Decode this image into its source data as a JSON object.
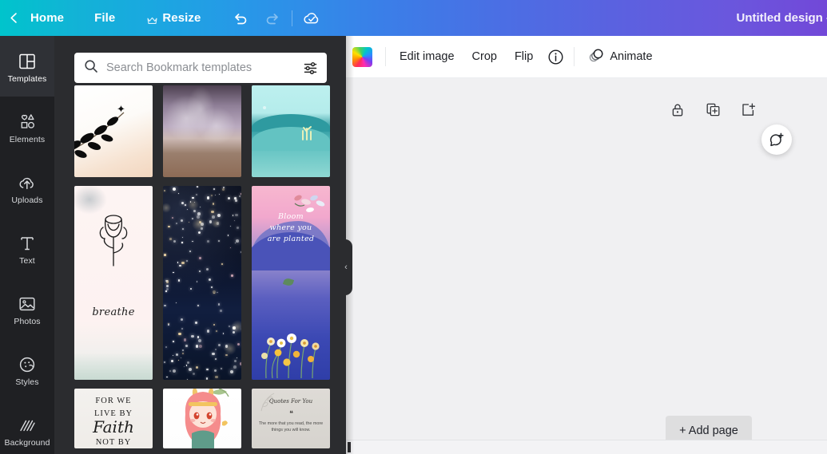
{
  "topbar": {
    "back_icon": "chevron-left-icon",
    "home_label": "Home",
    "file_label": "File",
    "resize_label": "Resize",
    "resize_icon": "crown-icon",
    "undo_icon": "undo-icon",
    "redo_icon": "redo-icon",
    "saved_icon": "cloud-check-icon",
    "doc_title": "Untitled design -"
  },
  "rail": {
    "items": [
      {
        "label": "Templates",
        "icon": "templates-icon",
        "active": true
      },
      {
        "label": "Elements",
        "icon": "elements-icon",
        "active": false
      },
      {
        "label": "Uploads",
        "icon": "upload-cloud-icon",
        "active": false
      },
      {
        "label": "Text",
        "icon": "text-icon",
        "active": false
      },
      {
        "label": "Photos",
        "icon": "photo-icon",
        "active": false
      },
      {
        "label": "Styles",
        "icon": "palette-icon",
        "active": false
      },
      {
        "label": "Background",
        "icon": "background-icon",
        "active": false
      }
    ]
  },
  "panel": {
    "search": {
      "placeholder": "Search Bookmark templates",
      "value": "",
      "search_icon": "search-icon",
      "filter_icon": "tune-sliders-icon"
    },
    "collapse_icon": "chevron-left-icon",
    "templates": [
      {
        "name": "black-leaves-bookmark",
        "style": "t-leaf",
        "row": 1
      },
      {
        "name": "lavender-beach-bookmark",
        "style": "t-wave",
        "row": 1
      },
      {
        "name": "sea-coral-bookmark",
        "style": "t-sea",
        "row": 1
      },
      {
        "name": "rose-breathe-bookmark",
        "style": "t-rose",
        "row": 2,
        "text": "breathe"
      },
      {
        "name": "starry-night-bookmark",
        "style": "t-stars",
        "row": 2
      },
      {
        "name": "bloom-where-planted-bookmark",
        "style": "t-bloom",
        "row": 2,
        "text": "Bloom\nwhere you\nare planted"
      },
      {
        "name": "live-by-faith-bookmark",
        "style": "t-faith",
        "row": 3,
        "lines": [
          "FOR WE",
          "LIVE BY",
          "Faith",
          "NOT BY"
        ]
      },
      {
        "name": "anime-girl-bookmark",
        "style": "t-anime",
        "row": 3
      },
      {
        "name": "reading-quote-bookmark",
        "style": "t-quote",
        "row": 3,
        "heading": "Quotes For You",
        "quote_mark": "❝",
        "quote": "The more that you read, the more things you will know."
      }
    ]
  },
  "editor": {
    "toolbar": {
      "color_swatch": "rainbow-color-swatch",
      "edit_image_label": "Edit image",
      "crop_label": "Crop",
      "flip_label": "Flip",
      "info_icon": "info-circle-icon",
      "animate_icon": "animate-icon",
      "animate_label": "Animate"
    },
    "page_tools": {
      "lock_icon": "lock-icon",
      "duplicate_icon": "duplicate-page-icon",
      "add_page_icon": "add-page-icon"
    },
    "canvas": {
      "page_name": "starry-night-page",
      "selection_color": "#8b3dd6",
      "background_color": "#0a0f1f"
    },
    "comment_icon": "add-comment-icon",
    "add_page_label": "+ Add page"
  }
}
